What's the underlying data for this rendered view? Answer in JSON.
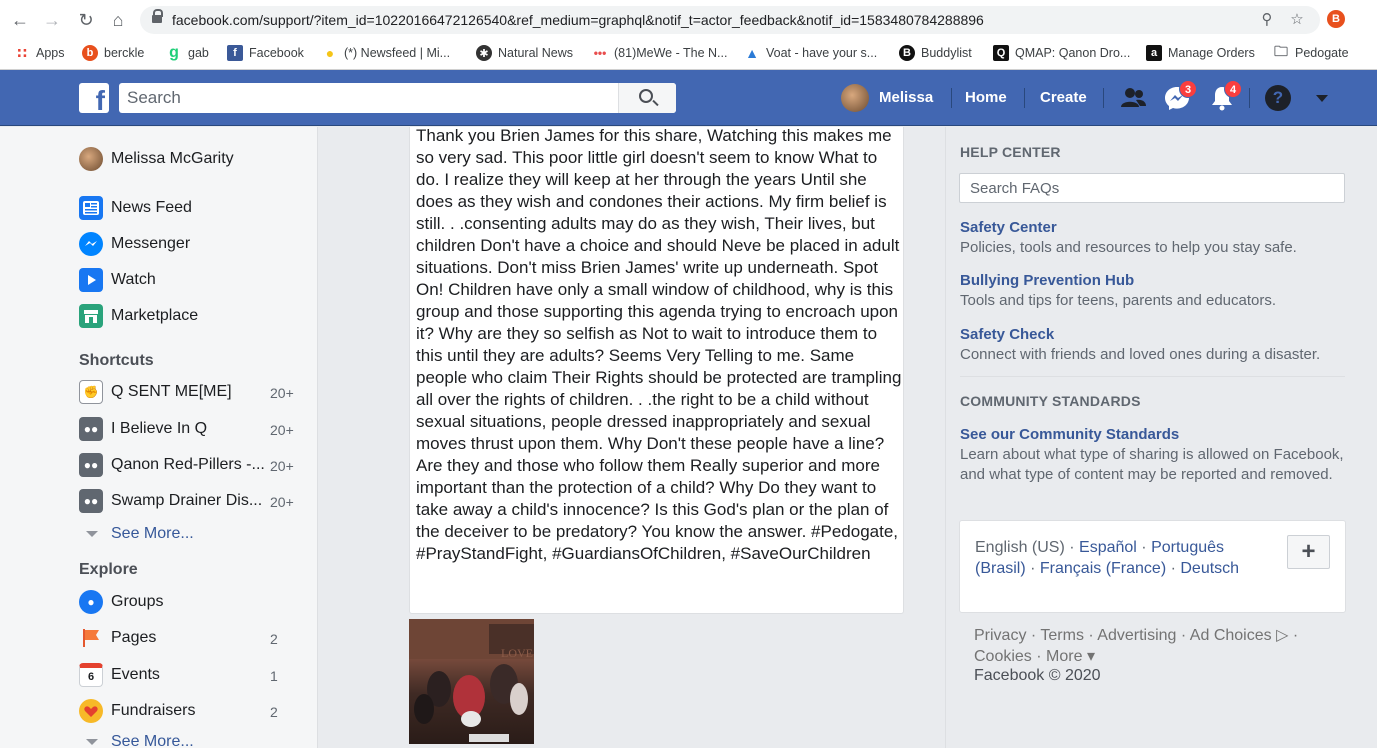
{
  "browser": {
    "url": "facebook.com/support/?item_id=10220166472126540&ref_medium=graphql&notif_t=actor_feedback&notif_id=1583480784288896",
    "bookmarks": [
      {
        "label": "Apps",
        "icon": "apps-grid-icon"
      },
      {
        "label": "berckle",
        "icon": "berckle-icon"
      },
      {
        "label": "gab",
        "icon": "gab-icon"
      },
      {
        "label": "Facebook",
        "icon": "facebook-icon"
      },
      {
        "label": "(*) Newsfeed | Mi...",
        "icon": "lightbulb-icon"
      },
      {
        "label": "Natural News",
        "icon": "natural-news-icon"
      },
      {
        "label": "(81)MeWe - The N...",
        "icon": "mewe-icon"
      },
      {
        "label": "Voat - have your s...",
        "icon": "voat-icon"
      },
      {
        "label": "Buddylist",
        "icon": "buddylist-icon"
      },
      {
        "label": "QMAP: Qanon Dro...",
        "icon": "qmap-icon"
      },
      {
        "label": "Manage Orders",
        "icon": "amazon-icon"
      },
      {
        "label": "Pedogate",
        "icon": "folder-icon"
      }
    ]
  },
  "topbar": {
    "logo": "f",
    "search_placeholder": "Search",
    "user_name": "Melissa",
    "home_label": "Home",
    "create_label": "Create",
    "messenger_badge": "3",
    "notifications_badge": "4",
    "help_label": "?"
  },
  "sidebar": {
    "profile_name": "Melissa McGarity",
    "nav": [
      {
        "label": "News Feed",
        "icon": "news-feed-icon"
      },
      {
        "label": "Messenger",
        "icon": "messenger-icon"
      },
      {
        "label": "Watch",
        "icon": "watch-icon"
      },
      {
        "label": "Marketplace",
        "icon": "marketplace-icon"
      }
    ],
    "shortcuts_heading": "Shortcuts",
    "shortcuts": [
      {
        "label": "Q SENT ME[ME]",
        "count": "20+"
      },
      {
        "label": "I Believe In Q",
        "count": "20+"
      },
      {
        "label": "Qanon Red-Pillers -...",
        "count": "20+"
      },
      {
        "label": "Swamp Drainer Dis...",
        "count": "20+"
      }
    ],
    "see_more_label": "See More...",
    "explore_heading": "Explore",
    "explore": [
      {
        "label": "Groups",
        "count": ""
      },
      {
        "label": "Pages",
        "count": "2"
      },
      {
        "label": "Events",
        "count": "1",
        "icon_text": "6"
      },
      {
        "label": "Fundraisers",
        "count": "2"
      }
    ],
    "see_more_label_2": "See More..."
  },
  "post": {
    "text": "Thank you Brien James for this share, Watching this makes me so very sad. This poor little girl doesn't seem to know What to do. I realize they will keep at her through the years Until she does as they wish and condones their actions. My firm belief is still. . .consenting adults may do as they wish, Their lives, but children Don't have a choice and should Neve be placed in adult situations. Don't miss Brien James' write up underneath. Spot On! Children have only a small window of childhood, why is this group and those supporting this agenda trying to encroach upon it? Why are they so selfish as Not to wait to introduce them to this until they are adults? Seems Very Telling to me. Same people who claim Their Rights should be protected are trampling all over the rights of children. . .the right to be a child without sexual situations, people dressed inappropriately and sexual moves thrust upon them. Why Don't these people have a line? Are they and those who follow them Really superior and more important than the protection of a child? Why Do they want to take away a child's innocence? Is this God's plan or the plan of the deceiver to be predatory? You know the answer. #Pedogate, #PrayStandFight, #GuardiansOfChildren, #SaveOurChildren"
  },
  "right": {
    "help_heading": "HELP CENTER",
    "search_placeholder": "Search FAQs",
    "help_links": [
      {
        "title": "Safety Center",
        "desc": "Policies, tools and resources to help you stay safe."
      },
      {
        "title": "Bullying Prevention Hub",
        "desc": "Tools and tips for teens, parents and educators."
      },
      {
        "title": "Safety Check",
        "desc": "Connect with friends and loved ones during a disaster."
      }
    ],
    "community_heading": "COMMUNITY STANDARDS",
    "community_link": "See our Community Standards",
    "community_desc": "Learn about what type of sharing is allowed on Facebook, and what type of content may be reported and removed.",
    "languages": {
      "current": "English (US)",
      "others": [
        "Español",
        "Português (Brasil)",
        "Français (France)",
        "Deutsch"
      ],
      "add_label": "+"
    },
    "footer_links": [
      "Privacy",
      "Terms",
      "Advertising",
      "Ad Choices",
      "Cookies",
      "More"
    ],
    "copyright": "Facebook © 2020"
  },
  "colors": {
    "fb_blue": "#4267b2",
    "link_blue": "#385898",
    "badge_red": "#fa3e3e"
  }
}
